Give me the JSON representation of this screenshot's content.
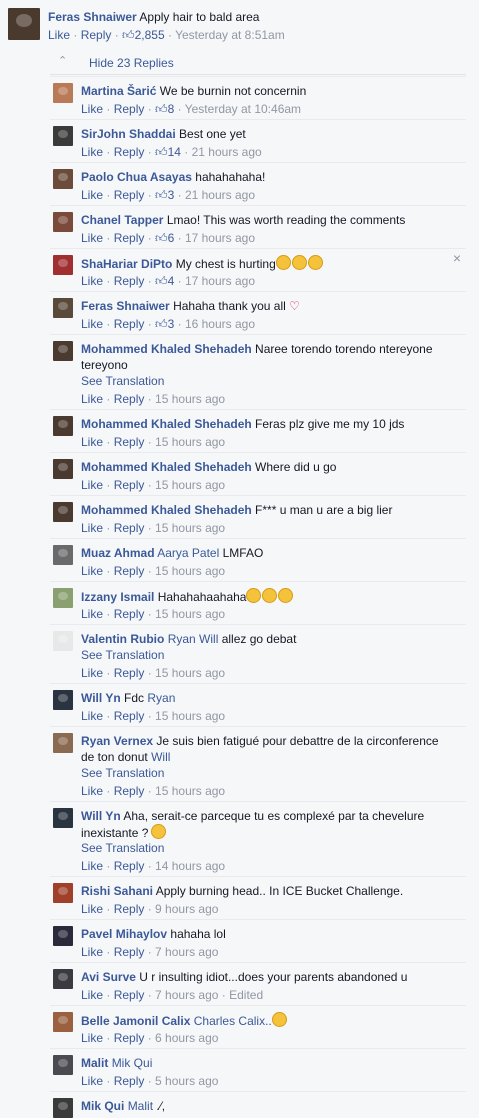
{
  "main": {
    "name": "Feras Shnaiwer",
    "text": "Apply hair to bald area",
    "like": "Like",
    "reply": "Reply",
    "likes": "2,855",
    "time": "Yesterday at 8:51am"
  },
  "hide_label": "Hide 23 Replies",
  "replies": [
    {
      "name": "Martina Šarić",
      "text": "We be burnin not concernin",
      "likes": "8",
      "time": "Yesterday at 10:46am",
      "color": "#b97a57"
    },
    {
      "name": "SirJohn Shaddai",
      "text": "Best one yet",
      "likes": "14",
      "time": "21 hours ago",
      "color": "#3a3a3a"
    },
    {
      "name": "Paolo Chua Asayas",
      "text": "hahahahaha!",
      "likes": "3",
      "time": "21 hours ago",
      "color": "#6b4b3a"
    },
    {
      "name": "Chanel Tapper",
      "text": "Lmao! This was worth reading the comments",
      "likes": "6",
      "time": "17 hours ago",
      "color": "#7a4a3a"
    },
    {
      "name": "ShaHariar DiPto",
      "text": "My chest is hurting",
      "likes": "4",
      "time": "17 hours ago",
      "color": "#a03030"
    },
    {
      "name": "Feras Shnaiwer",
      "text": "Hahaha thank you all",
      "likes": "3",
      "time": "16 hours ago",
      "color": "#5a4a3a"
    },
    {
      "name": "Mohammed Khaled Shehadeh",
      "text": "Naree torendo torendo ntereyone",
      "text2": "tereyono",
      "see": "See Translation",
      "time": "15 hours ago",
      "color": "#4a3a30"
    },
    {
      "name": "Mohammed Khaled Shehadeh",
      "text": "Feras plz give me my 10 jds",
      "time": "15 hours ago",
      "color": "#4a3a30"
    },
    {
      "name": "Mohammed Khaled Shehadeh",
      "text": "Where did u go",
      "time": "15 hours ago",
      "color": "#4a3a30"
    },
    {
      "name": "Mohammed Khaled Shehadeh",
      "text": "F*** u man u are a big lier",
      "time": "15 hours ago",
      "color": "#4a3a30"
    },
    {
      "name": "Muaz Ahmad",
      "tag": "Aarya Patel",
      "text": "LMFAO",
      "time": "15 hours ago",
      "color": "#6a6a6a"
    },
    {
      "name": "Izzany Ismail",
      "text": "Hahahahaahaha",
      "time": "15 hours ago",
      "color": "#8aa070"
    },
    {
      "name": "Valentin Rubio",
      "tag": "Ryan Will",
      "text": "allez go debat",
      "see": "See Translation",
      "time": "15 hours ago",
      "color": "#e8e8e8"
    },
    {
      "name": "Will Yn",
      "text": "Fdc",
      "tag2": "Ryan",
      "time": "15 hours ago",
      "color": "#2a3340"
    },
    {
      "name": "Ryan Vernex",
      "text": "Je suis bien fatigué pour debattre de la circonference",
      "text2": "de ton donut",
      "tag2": "Will",
      "see": "See Translation",
      "time": "15 hours ago",
      "color": "#8a6a50"
    },
    {
      "name": "Will Yn",
      "text": "Aha, serait-ce parceque tu es complexé par ta chevelure",
      "text2": "inexistante ?",
      "see": "See Translation",
      "time": "14 hours ago",
      "color": "#2a3340"
    },
    {
      "name": "Rishi Sahani",
      "text": "Apply burning head.. In ICE Bucket Challenge.",
      "time": "9 hours ago",
      "color": "#a0402a"
    },
    {
      "name": "Pavel Mihaylov",
      "text": "hahaha lol",
      "time": "7 hours ago",
      "color": "#2a2a3a"
    },
    {
      "name": "Avi Surve",
      "text": "U r insulting idiot...does your parents abandoned u",
      "time": "7 hours ago",
      "edited": "Edited",
      "color": "#3a3a40"
    },
    {
      "name": "Belle Jamonil Calix",
      "tag": "Charles Calix..",
      "time": "6 hours ago",
      "color": "#9a6040"
    },
    {
      "name": "Malit",
      "tag": "Mik Qui",
      "time": "5 hours ago",
      "color": "#4a4a50"
    },
    {
      "name": "Mik Qui",
      "tag": "Malit",
      "text": ".⁄,",
      "color": "#3a3a3a"
    }
  ],
  "like_label": "Like",
  "reply_label": "Reply",
  "see_translation": "See Translation",
  "close_icon": "×"
}
